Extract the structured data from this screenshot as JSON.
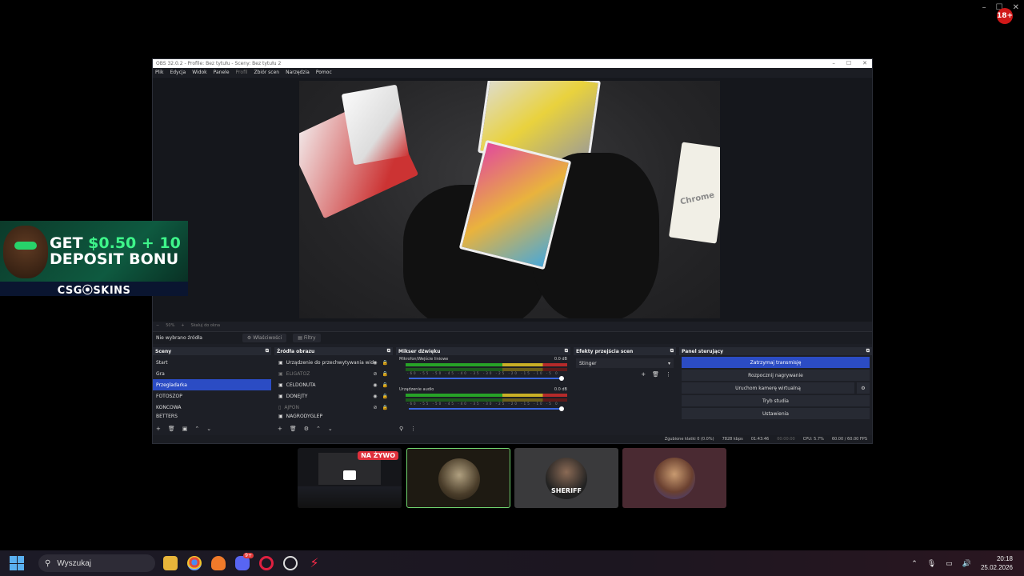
{
  "viewer": {
    "window_controls": [
      "–",
      "☐",
      "✕"
    ],
    "avatar_badge": "18+"
  },
  "obs": {
    "title": "OBS 32.0.2 - Profile: Bez tytułu - Sceny: Bez tytułu 2",
    "title_controls": [
      "–",
      "☐",
      "✕"
    ],
    "menu": [
      "Plik",
      "Edycja",
      "Widok",
      "Panele",
      "Profil",
      "Zbiór scen",
      "Narzędzia",
      "Pomoc"
    ],
    "zoom_label": "50%",
    "scale_label": "Skaluj do okna",
    "no_source": "Nie wybrano źródła",
    "properties_btn": "Właściwości",
    "filters_btn": "Filtry",
    "scenes": {
      "header": "Sceny",
      "items": [
        "Start",
        "Gra",
        "Przegladarka",
        "FOTOSZOP",
        "KONCOWA",
        "BETTERS"
      ]
    },
    "sources": {
      "header": "Źródła obrazu",
      "items": [
        "Urządzenie do przechwytywania wid",
        "ELIGATOZ",
        "CELDONUTA",
        "DONEJTY",
        "AJPON",
        "NAGRODYGLEP"
      ]
    },
    "mixer": {
      "header": "Mikser dźwięku",
      "channels": [
        {
          "name": "Mikrofon/Wejście liniowe",
          "db": "0.0 dB"
        },
        {
          "name": "Urządzenie audio",
          "db": "0.0 dB"
        }
      ],
      "scale": "-60 -55 -50 -45 -40 -35 -30 -25 -20 -15 -10 -5 0"
    },
    "transitions": {
      "header": "Efekty przejścia scen",
      "selected": "Stinger"
    },
    "controls": {
      "header": "Panel sterujący",
      "buttons": [
        "Zatrzymaj transmisję",
        "Rozpocznij nagrywanie",
        "Uruchom kamerę wirtualną",
        "Tryb studia",
        "Ustawienia"
      ]
    },
    "status": {
      "dropped": "Zgubione klatki 0 (0.0%)",
      "kbps": "7828 kbps",
      "stream_time": "01:43:46",
      "rec_time": "00:00:00",
      "cpu": "CPU: 5.7%",
      "fps": "60.00 / 60.00 FPS"
    }
  },
  "preview": {
    "box_text": "Chrome"
  },
  "ad": {
    "line1_prefix": "GET ",
    "line1_amount": "$0.50 + 10",
    "line2": "DEPOSIT BONU",
    "logo": "CSG⦿SKINS"
  },
  "tiles": {
    "live_label": "NA ŻYWO",
    "sheriff_label": "SHERIFF"
  },
  "taskbar": {
    "search_placeholder": "Wyszukaj",
    "time": "20:18",
    "date": "25.02.2026",
    "discord_badge": "9+"
  },
  "colors": {
    "accent": "#2b4cc4",
    "live_red": "#e0303c",
    "tile_active_border": "#6fd36f"
  }
}
